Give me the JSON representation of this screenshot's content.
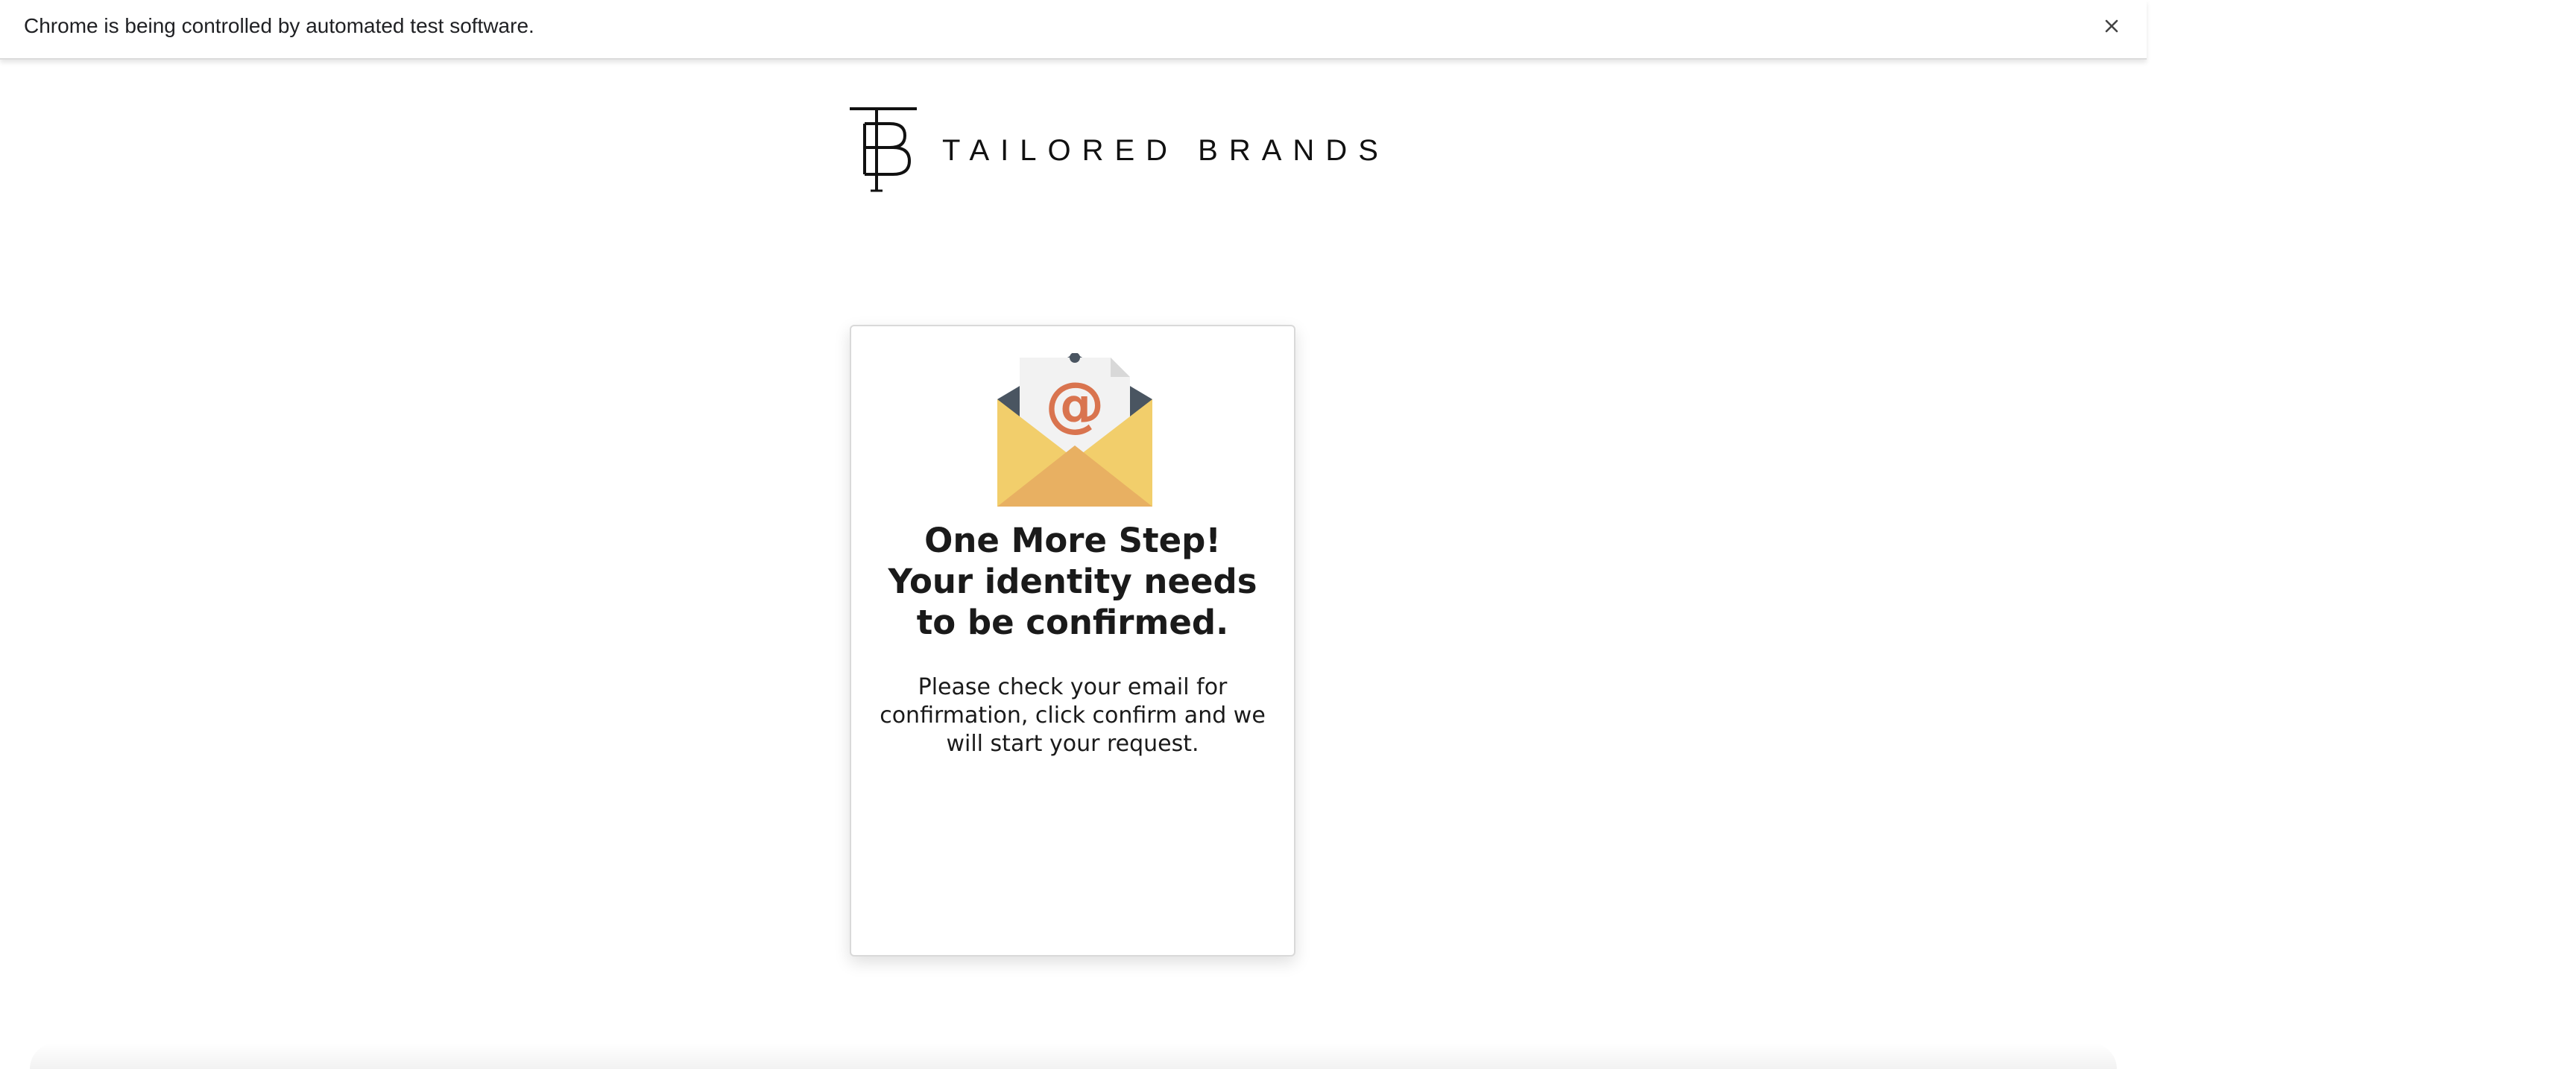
{
  "infobar": {
    "message": "Chrome is being controlled by automated test software.",
    "close_icon": "close-icon"
  },
  "brand": {
    "logo_icon": "tailored-brands-monogram-icon",
    "name": "TAILORED BRANDS"
  },
  "card": {
    "illustration_icon": "email-envelope-icon",
    "heading_line1": "One More Step!",
    "heading_line2": "Your identity needs to be confirmed.",
    "body": "Please check your email for confirmation, click confirm and we will start your request."
  },
  "colors": {
    "envelope_yellow": "#F2CE6B",
    "envelope_flap": "#E8B062",
    "envelope_dark": "#4A5561",
    "letter_paper": "#F2F2F2",
    "at_sign": "#D9744F",
    "text": "#1A1A1A"
  }
}
